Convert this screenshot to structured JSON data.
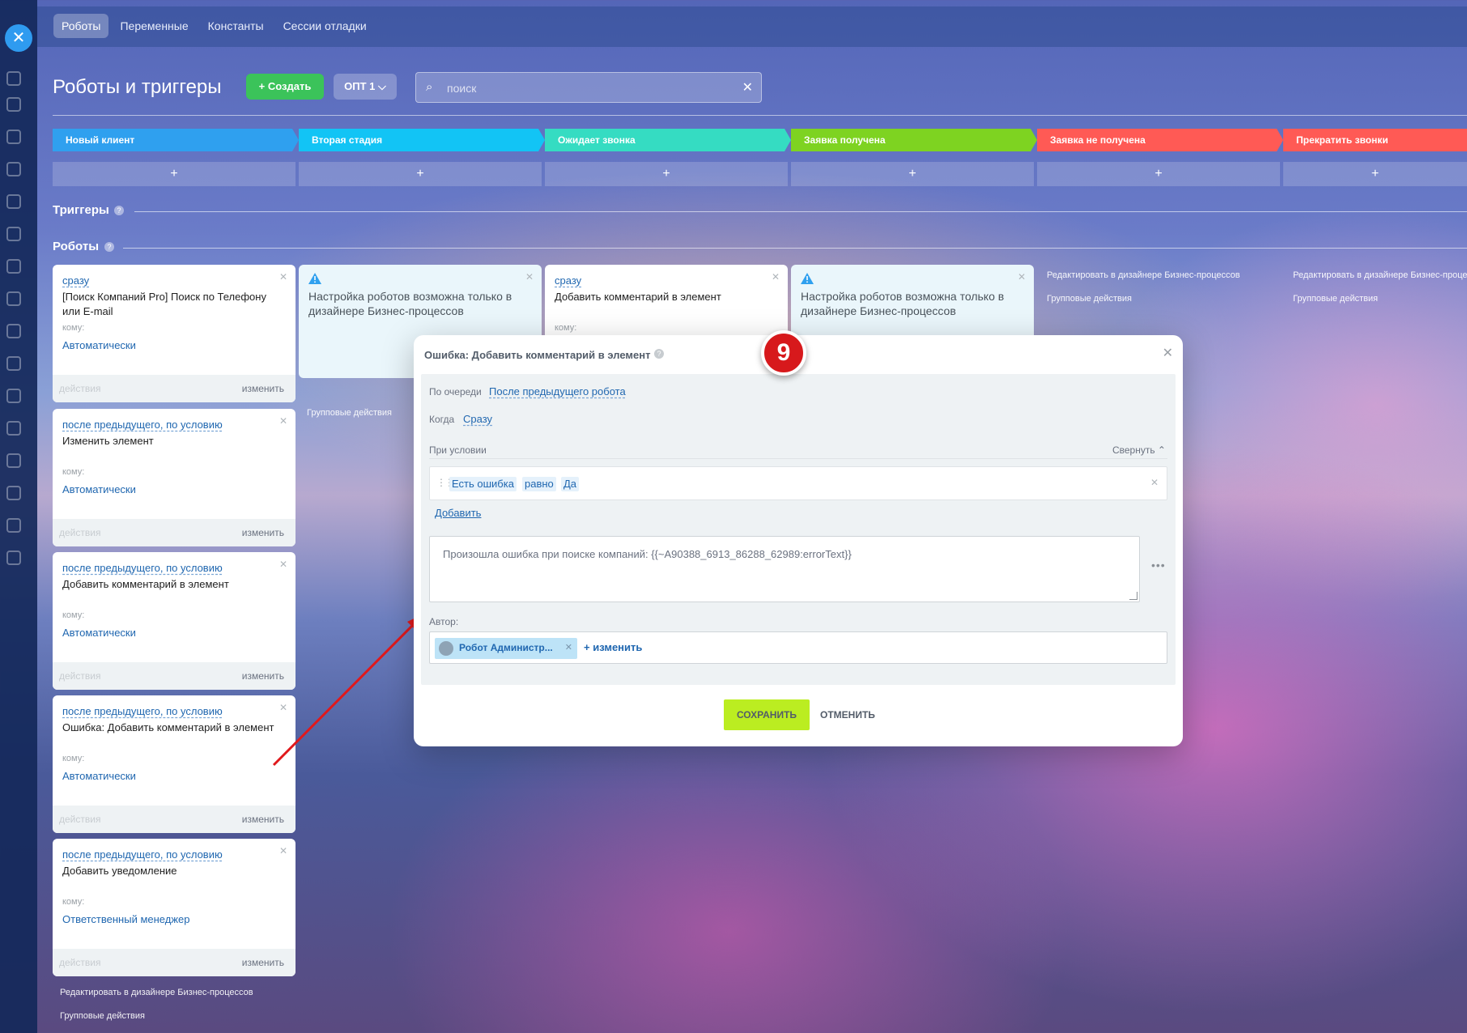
{
  "colors": {
    "stage_new": "#2fa0ef",
    "stage_second": "#12c4f5",
    "stage_waiting": "#35dcc2",
    "stage_received": "#7ed321",
    "stage_not_received": "#ff5a55",
    "stage_stop": "#ff5a55",
    "save_button": "#bbed21",
    "create_button": "#3bc35a",
    "annotation_badge": "#d7191c"
  },
  "header": {
    "tabs": [
      "Роботы",
      "Переменные",
      "Константы",
      "Сессии отладки"
    ],
    "title": "Роботы и триггеры",
    "create_label": "+ Создать",
    "opt_label": "ОПТ 1 ⌵",
    "search_placeholder": "поиск",
    "search_icon": "search-icon",
    "clear_icon": "close-icon"
  },
  "stages": [
    {
      "name": "Новый клиент"
    },
    {
      "name": "Вторая стадия"
    },
    {
      "name": "Ожидает звонка"
    },
    {
      "name": "Заявка получена"
    },
    {
      "name": "Заявка не получена"
    },
    {
      "name": "Прекратить звонки"
    }
  ],
  "sections": {
    "triggers": "Триггеры",
    "robots": "Роботы",
    "help": "?"
  },
  "column1": {
    "cards": [
      {
        "when": "сразу",
        "name": "[Поиск Компаний Pro] Поиск по Телефону или E-mail",
        "to_label": "кому:",
        "to": "Автоматически",
        "foot_left": "действия",
        "foot_right": "изменить"
      },
      {
        "when": "после предыдущего, по условию",
        "name": "Изменить элемент",
        "to_label": "кому:",
        "to": "Автоматически",
        "foot_left": "действия",
        "foot_right": "изменить"
      },
      {
        "when": "после предыдущего, по условию",
        "name": "Добавить комментарий в элемент",
        "to_label": "кому:",
        "to": "Автоматически",
        "foot_left": "действия",
        "foot_right": "изменить"
      },
      {
        "when": "после предыдущего, по условию",
        "name": "Ошибка: Добавить комментарий в элемент",
        "to_label": "кому:",
        "to": "Автоматически",
        "foot_left": "действия",
        "foot_right": "изменить"
      },
      {
        "when": "после предыдущего, по условию",
        "name": "Добавить уведомление",
        "to_label": "кому:",
        "to": "Ответственный менеджер",
        "foot_left": "действия",
        "foot_right": "изменить"
      }
    ],
    "edit_link": "Редактировать в дизайнере Бизнес-процессов",
    "group_link": "Групповые действия"
  },
  "column2": {
    "warning": "Настройка роботов возможна только в дизайнере Бизнес-процессов",
    "group_link": "Групповые действия"
  },
  "column3": {
    "card": {
      "when": "сразу",
      "name": "Добавить комментарий в элемент",
      "to_label": "кому:"
    }
  },
  "column4": {
    "warning": "Настройка роботов возможна только в дизайнере Бизнес-процессов"
  },
  "column5": {
    "edit_link": "Редактировать в дизайнере Бизнес-процессов",
    "group_link": "Групповые действия"
  },
  "column6": {
    "edit_link": "Редактировать в дизайнере Бизнес-процессов",
    "group_link": "Групповые действия"
  },
  "dialog": {
    "title": "Ошибка: Добавить комментарий в элемент",
    "help": "?",
    "order_label": "По очереди",
    "order_value": "После предыдущего робота",
    "when_label": "Когда",
    "when_value": "Сразу",
    "condition_label": "При условии",
    "collapse_label": "Свернуть ⌃",
    "condition": {
      "field": "Есть ошибка",
      "operator": "равно",
      "value": "Да"
    },
    "add_label": "Добавить",
    "message": "Произошла ошибка при поиске компаний: {{~A90388_6913_86288_62989:errorText}}",
    "more": "•••",
    "author_label": "Автор:",
    "author_name": "Робот Администр...",
    "author_add": "+ изменить",
    "save_label": "СОХРАНИТЬ",
    "cancel_label": "ОТМЕНИТЬ"
  },
  "annotation": {
    "badge": "9"
  }
}
